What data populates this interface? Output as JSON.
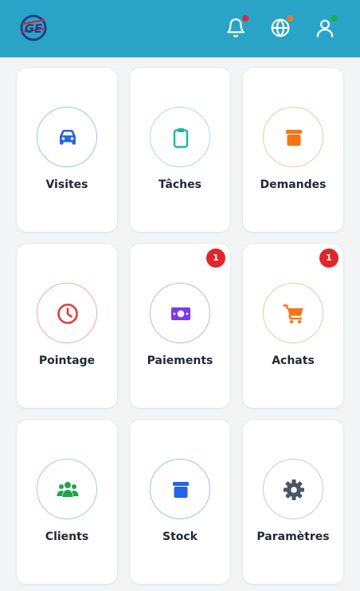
{
  "header": {
    "logo_name": "GE",
    "bg_color": "#2aa4c6",
    "icons": [
      {
        "name": "bell-icon",
        "dot_color": "#e0263f"
      },
      {
        "name": "globe-icon",
        "dot_color": "#f0782a"
      },
      {
        "name": "user-icon",
        "dot_color": "#1fae4b"
      }
    ]
  },
  "tiles": [
    {
      "label": "Visites",
      "icon": "car-icon",
      "color": "#2563eb",
      "badge": null
    },
    {
      "label": "Tâches",
      "icon": "clipboard-icon",
      "color": "#14b8a6",
      "badge": null
    },
    {
      "label": "Demandes",
      "icon": "box-icon",
      "color": "#f97316",
      "badge": null
    },
    {
      "label": "Pointage",
      "icon": "clock-icon",
      "color": "#e23b3b",
      "badge": null
    },
    {
      "label": "Paiements",
      "icon": "money-icon",
      "color": "#7c3aed",
      "badge": "1"
    },
    {
      "label": "Achats",
      "icon": "cart-icon",
      "color": "#f97316",
      "badge": "1"
    },
    {
      "label": "Clients",
      "icon": "users-icon",
      "color": "#22a34a",
      "badge": null
    },
    {
      "label": "Stock",
      "icon": "stock-box-icon",
      "color": "#2563eb",
      "badge": null
    },
    {
      "label": "Paramètres",
      "icon": "gear-icon",
      "color": "#4b5563",
      "badge": null
    }
  ]
}
